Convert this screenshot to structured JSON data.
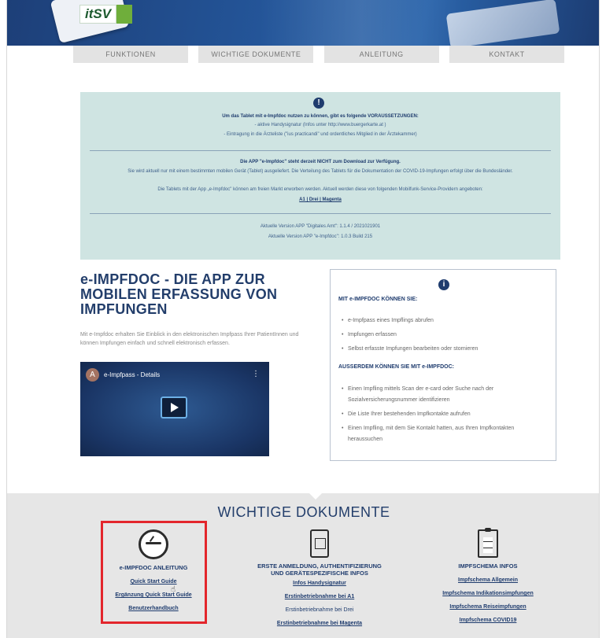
{
  "brand": {
    "logo": "itSV"
  },
  "nav": [
    "FUNKTIONEN",
    "WICHTIGE DOKUMENTE",
    "ANLEITUNG",
    "KONTAKT"
  ],
  "info": {
    "icon": "exclamation-icon",
    "intro": "Um das Tablet mit e-Impfdoc nutzen zu können, gibt es folgende VORAUSSETZUNGEN:",
    "req1": "- aktive Handysignatur (Infos unter http://www.buergerkarte.at )",
    "req2": "- Eintragung in die Ärzteliste (\"ius practicandi\" und ordentliches Mitglied in der Ärztekammer)",
    "download_title": "Die APP \"e-Impfdoc\" steht derzeit NICHT zum Download zur Verfügung.",
    "download_p1": "Sie wird aktuell nur mit einem bestimmten mobilen Gerät (Tablet) ausgeliefert. Die Verteilung des Tablets für die Dokumentation der COVID-19-Impfungen erfolgt über die Bundesländer.",
    "download_p2": "Die Tablets mit der App „e-Impfdoc\" können am freien Markt erworben werden. Aktuell werden diese von folgenden Mobilfunk-Service-Providern angeboten:",
    "providers": "A1 | Drei | Magenta",
    "version1": "Aktuelle Version APP \"Digitales Amt\": 1.1.4 / 2021021901",
    "version2": "Aktuelle Version APP \"e-Impfdoc\": 1.0.3 Build 215"
  },
  "main": {
    "title": "e-IMPFDOC - DIE APP ZUR MOBILEN ERFASSUNG VON IMPFUNGEN",
    "description": "Mit e-Impfdoc erhalten Sie Einblick in den elektronischen Impfpass Ihrer PatientInnen und können Impfungen einfach und schnell elektronisch erfassen."
  },
  "video": {
    "avatar": "A",
    "title": "e-Impfpass - Details",
    "menu": "⋮"
  },
  "features": {
    "heading1": "MIT e-IMPFDOC KÖNNEN SIE:",
    "list1": [
      "e-Impfpass eines Impflings abrufen",
      "Impfungen erfassen",
      "Selbst erfasste Impfungen bearbeiten oder stornieren"
    ],
    "heading2": "AUSSERDEM KÖNNEN SIE MIT e-IMPFDOC:",
    "list2": [
      "Einen Impfling mittels Scan der e-card oder Suche nach der Sozialversicherungsnummer identifizieren",
      "Die Liste Ihrer bestehenden Impfkontakte aufrufen",
      "Einen Impfling, mit dem Sie Kontakt hatten, aus Ihren Impfkontakten heraussuchen"
    ]
  },
  "docs": {
    "title": "WICHTIGE DOKUMENTE",
    "col1": {
      "title": "e-IMPFDOC ANLEITUNG",
      "links": [
        "Quick Start Guide",
        "Ergänzung Quick Start Guide",
        "Benutzerhandbuch"
      ]
    },
    "col2": {
      "title1": "ERSTE ANMELDUNG, AUTHENTIFIZIERUNG",
      "title2": "UND GERÄTESPEZIFISCHE INFOS",
      "links": [
        "Infos Handysignatur",
        "Erstinbetriebnahme bei A1",
        "Erstinbetriebnahme bei Drei",
        "Erstinbetriebnahme bei Magenta"
      ]
    },
    "col3": {
      "title": "IMPFSCHEMA INFOS",
      "links": [
        "Impfschema Allgemein",
        "Impfschema Indikationsimpfungen",
        "Impfschema Reiseimpfungen",
        "Impfschema COVID19"
      ]
    }
  },
  "colors": {
    "primary": "#1f3c6e",
    "info_bg": "#cfe4e2",
    "highlight": "#e3262c",
    "docs_bg": "#e6e6e6"
  }
}
